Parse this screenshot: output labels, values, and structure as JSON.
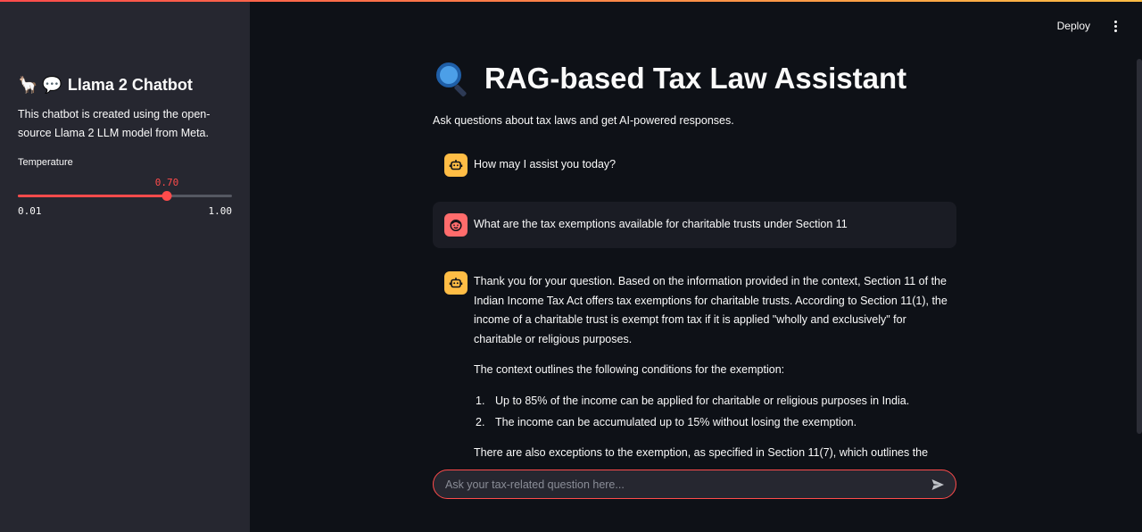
{
  "sidebar": {
    "title_emoji": "🦙 💬",
    "title": "Llama 2 Chatbot",
    "description": "This chatbot is created using the open-source Llama 2 LLM model from Meta.",
    "slider": {
      "label": "Temperature",
      "value": 0.7,
      "value_text": "0.70",
      "min": 0.01,
      "min_text": "0.01",
      "max": 1.0,
      "max_text": "1.00"
    }
  },
  "header": {
    "deploy_label": "Deploy",
    "menu_icon": "kebab-menu-icon"
  },
  "main": {
    "title": "RAG-based Tax Law Assistant",
    "title_icon": "magnifying-glass-icon",
    "subtitle": "Ask questions about tax laws and get AI-powered responses."
  },
  "messages": [
    {
      "role": "assistant",
      "icon": "robot-icon",
      "text": "How may I assist you today?"
    },
    {
      "role": "user",
      "icon": "smiley-face-icon",
      "text": "What are the tax exemptions available for charitable trusts under Section 11"
    },
    {
      "role": "assistant",
      "icon": "robot-icon",
      "paragraph1": "Thank you for your question. Based on the information provided in the context, Section 11 of the Indian Income Tax Act offers tax exemptions for charitable trusts. According to Section 11(1), the income of a charitable trust is exempt from tax if it is applied \"wholly and exclusively\" for charitable or religious purposes.",
      "paragraph2": "The context outlines the following conditions for the exemption:",
      "list": [
        {
          "num": "1.",
          "text": "Up to 85% of the income can be applied for charitable or religious purposes in India."
        },
        {
          "num": "2.",
          "text": "The income can be accumulated up to 15% without losing the exemption."
        }
      ],
      "paragraph3": "There are also exceptions to the exemption, as specified in Section 11(7), which outlines the"
    }
  ],
  "chat_input": {
    "value": "",
    "placeholder": "Ask your tax-related question here...",
    "send_icon": "send-icon"
  },
  "colors": {
    "accent": "#ff4b4b",
    "background": "#0e1117",
    "sidebar": "#262730",
    "bot_avatar": "#ffbd45",
    "user_avatar": "#ff6c6c"
  }
}
